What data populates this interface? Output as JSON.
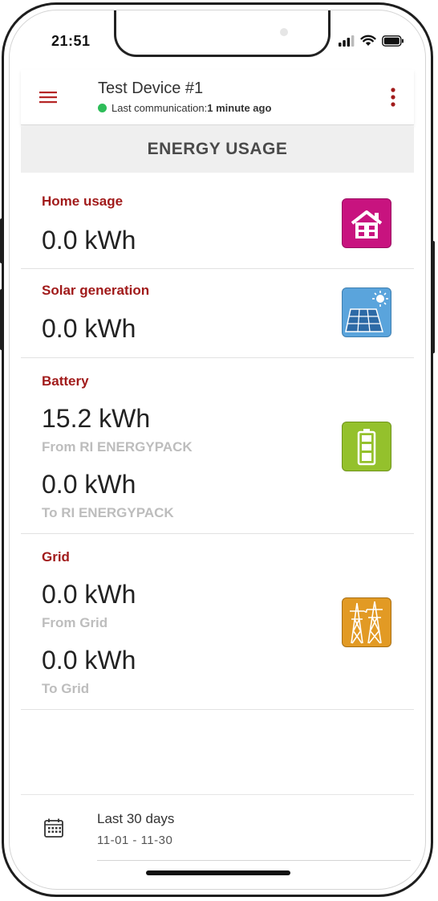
{
  "status_bar": {
    "time": "21:51"
  },
  "app_bar": {
    "device_title": "Test Device #1",
    "comm_label": "Last communication:",
    "comm_value": "1 minute ago"
  },
  "section": {
    "title": "ENERGY USAGE"
  },
  "cards": {
    "home": {
      "title": "Home usage",
      "value": "0.0 kWh",
      "icon": "house-icon",
      "color": "#c8137f"
    },
    "solar": {
      "title": "Solar generation",
      "value": "0.0 kWh",
      "icon": "solar-panel-icon",
      "color": "#5aa4dc"
    },
    "battery": {
      "title": "Battery",
      "from_value": "15.2 kWh",
      "from_label": "From RI ENERGYPACK",
      "to_value": "0.0 kWh",
      "to_label": "To RI ENERGYPACK",
      "icon": "battery-icon",
      "color": "#94c12c"
    },
    "grid": {
      "title": "Grid",
      "from_value": "0.0 kWh",
      "from_label": "From Grid",
      "to_value": "0.0 kWh",
      "to_label": "To Grid",
      "icon": "power-pylon-icon",
      "color": "#e29a24"
    }
  },
  "footer": {
    "range_label": "Last 30 days",
    "range_dates": "11-01 - 11-30"
  },
  "colors": {
    "accent": "#a11b1b",
    "online": "#2ebd59"
  }
}
